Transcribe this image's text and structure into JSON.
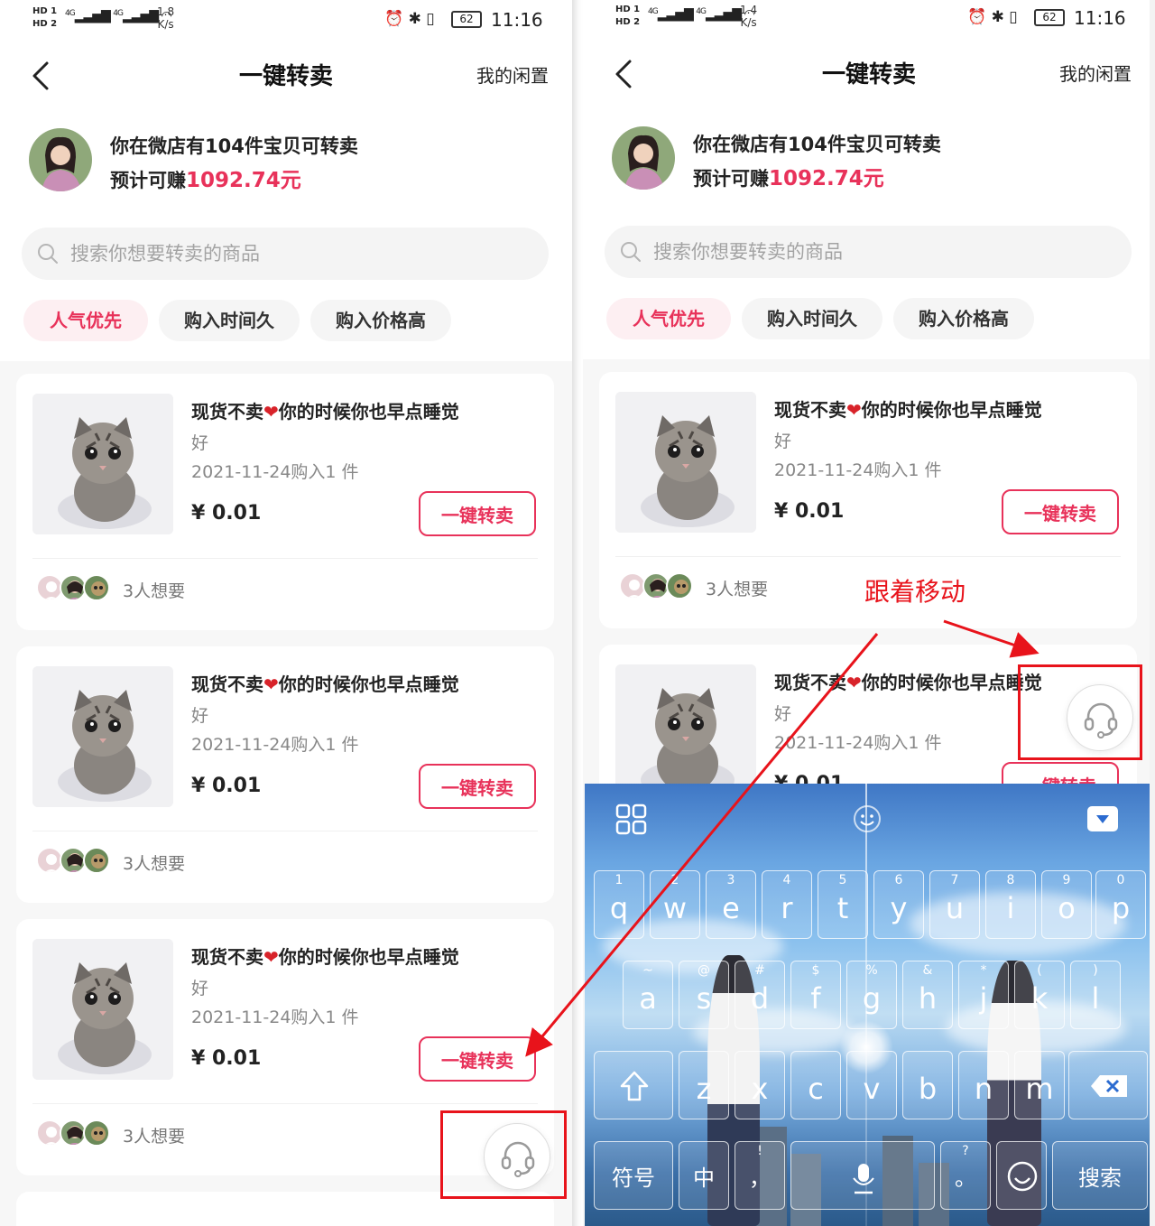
{
  "status": {
    "hd1": "HD 1",
    "hd2": "HD 2",
    "net_left": "4G",
    "net_right": "4G",
    "speed_left_value": "1.8",
    "speed_right_value": "1.4",
    "speed_unit": "K/s",
    "battery": "62",
    "time": "11:16"
  },
  "nav": {
    "title": "一键转卖",
    "right_link": "我的闲置"
  },
  "info": {
    "line1": "你在微店有104件宝贝可转卖",
    "line2_prefix": "预计可赚",
    "amount": "1092.74元"
  },
  "search": {
    "placeholder": "搜索你想要转卖的商品"
  },
  "tabs": [
    {
      "label": "人气优先",
      "active": true
    },
    {
      "label": "购入时间久",
      "active": false
    },
    {
      "label": "购入价格高",
      "active": false
    }
  ],
  "items": [
    {
      "title_before": "现货不卖",
      "heart": "❤",
      "title_after": "你的时候你也早点睡觉",
      "subtitle": "好",
      "date": "2021-11-24购入1 件",
      "price": "¥ 0.01",
      "button": "一键转卖",
      "want": "3人想要"
    },
    {
      "title_before": "现货不卖",
      "heart": "❤",
      "title_after": "你的时候你也早点睡觉",
      "subtitle": "好",
      "date": "2021-11-24购入1 件",
      "price": "¥ 0.01",
      "button": "一键转卖",
      "want": "3人想要"
    },
    {
      "title_before": "现货不卖",
      "heart": "❤",
      "title_after": "你的时候你也早点睡觉",
      "subtitle": "好",
      "date": "2021-11-24购入1 件",
      "price": "¥ 0.01",
      "button": "一键转卖",
      "want": "3人想要"
    }
  ],
  "annotation": "跟着移动",
  "keyboard": {
    "row1": [
      {
        "num": "1",
        "ltr": "q"
      },
      {
        "num": "2",
        "ltr": "w"
      },
      {
        "num": "3",
        "ltr": "e"
      },
      {
        "num": "4",
        "ltr": "r"
      },
      {
        "num": "5",
        "ltr": "t"
      },
      {
        "num": "6",
        "ltr": "y"
      },
      {
        "num": "7",
        "ltr": "u"
      },
      {
        "num": "8",
        "ltr": "i"
      },
      {
        "num": "9",
        "ltr": "o"
      },
      {
        "num": "0",
        "ltr": "p"
      }
    ],
    "row2": [
      {
        "num": "~",
        "ltr": "a"
      },
      {
        "num": "@",
        "ltr": "s"
      },
      {
        "num": "#",
        "ltr": "d"
      },
      {
        "num": "$",
        "ltr": "f"
      },
      {
        "num": "%",
        "ltr": "g"
      },
      {
        "num": "&",
        "ltr": "h"
      },
      {
        "num": "*",
        "ltr": "j"
      },
      {
        "num": "(",
        "ltr": "k"
      },
      {
        "num": ")",
        "ltr": "l"
      }
    ],
    "row3": [
      {
        "num": "",
        "ltr": "z"
      },
      {
        "num": "",
        "ltr": "x"
      },
      {
        "num": "",
        "ltr": "c"
      },
      {
        "num": "",
        "ltr": "v"
      },
      {
        "num": "",
        "ltr": "b"
      },
      {
        "num": "",
        "ltr": "n"
      },
      {
        "num": "",
        "ltr": "m"
      }
    ],
    "symbols": "符号",
    "chinese": "中",
    "comma_top": "!",
    "comma": "，",
    "period_top": "?",
    "period": "。",
    "search": "搜索"
  },
  "colors": {
    "accent": "#e8325a",
    "annotation_red": "#e8131b",
    "heart": "#d8232a"
  }
}
